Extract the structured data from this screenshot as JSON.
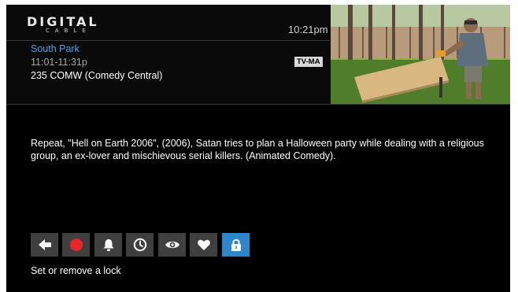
{
  "header": {
    "logo_top": "DIGITAL",
    "logo_bottom": "CABLE",
    "clock": "10:21pm"
  },
  "program": {
    "title": "South Park",
    "time": "11:01-11:31p",
    "channel": "235 COMW (Comedy Central)",
    "rating": "TV-MA"
  },
  "description": "Repeat, \"Hell on Earth 2006\", (2006), Satan tries to plan a Halloween party while dealing with a religious group, an ex-lover and mischievous serial killers. (Animated Comedy).",
  "actions": [
    {
      "icon": "back-arrow-icon",
      "selected": false
    },
    {
      "icon": "record-icon",
      "selected": false
    },
    {
      "icon": "bell-icon",
      "selected": false
    },
    {
      "icon": "clock-icon",
      "selected": false
    },
    {
      "icon": "eye-icon",
      "selected": false
    },
    {
      "icon": "heart-icon",
      "selected": false
    },
    {
      "icon": "lock-icon",
      "selected": true
    }
  ],
  "hint": "Set or remove a lock",
  "colors": {
    "accent_blue": "#2d86c9",
    "title_blue": "#4aa3e6",
    "record_red": "#e8262a",
    "button_gray": "#3f3f3f"
  }
}
